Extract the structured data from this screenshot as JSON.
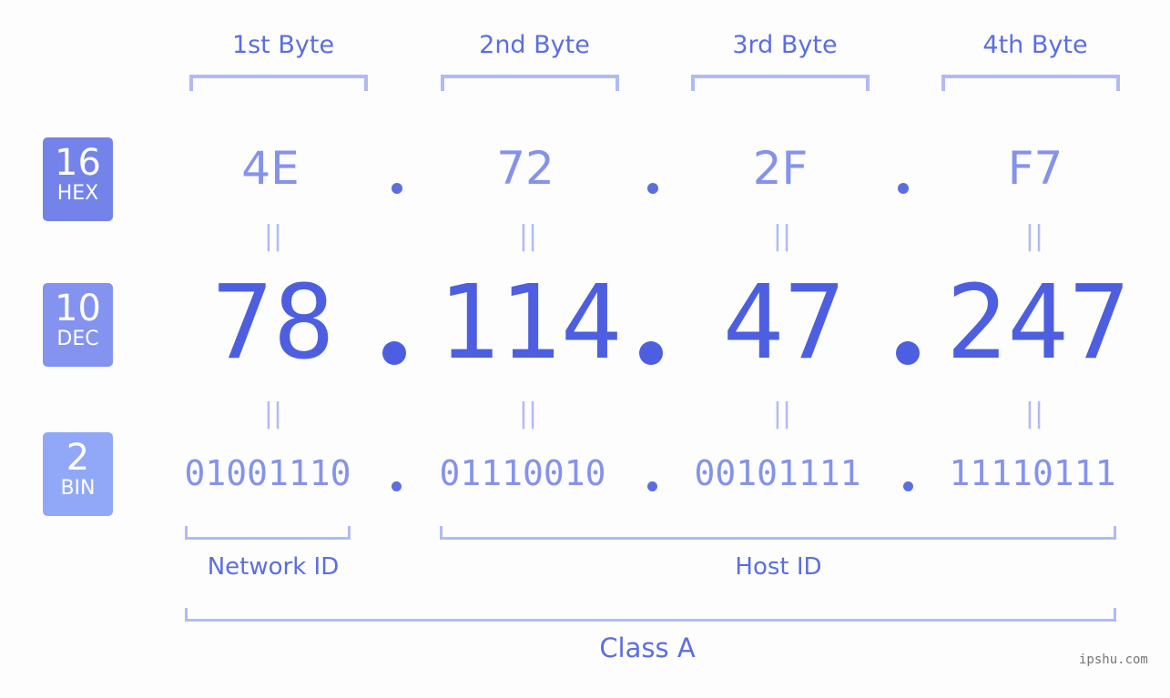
{
  "headers": [
    "1st Byte",
    "2nd Byte",
    "3rd Byte",
    "4th Byte"
  ],
  "badges": [
    {
      "number": "16",
      "label": "HEX",
      "color": "#7383ea"
    },
    {
      "number": "10",
      "label": "DEC",
      "color": "#8493f0"
    },
    {
      "number": "2",
      "label": "BIN",
      "color": "#91a8f8"
    }
  ],
  "hex": [
    "4E",
    "72",
    "2F",
    "F7"
  ],
  "dec": [
    "78",
    "114",
    "47",
    "247"
  ],
  "bin": [
    "01001110",
    "01110010",
    "00101111",
    "11110111"
  ],
  "equals": "||",
  "labels": {
    "network": "Network ID",
    "host": "Host ID",
    "class": "Class A"
  },
  "watermark": "ipshu.com"
}
